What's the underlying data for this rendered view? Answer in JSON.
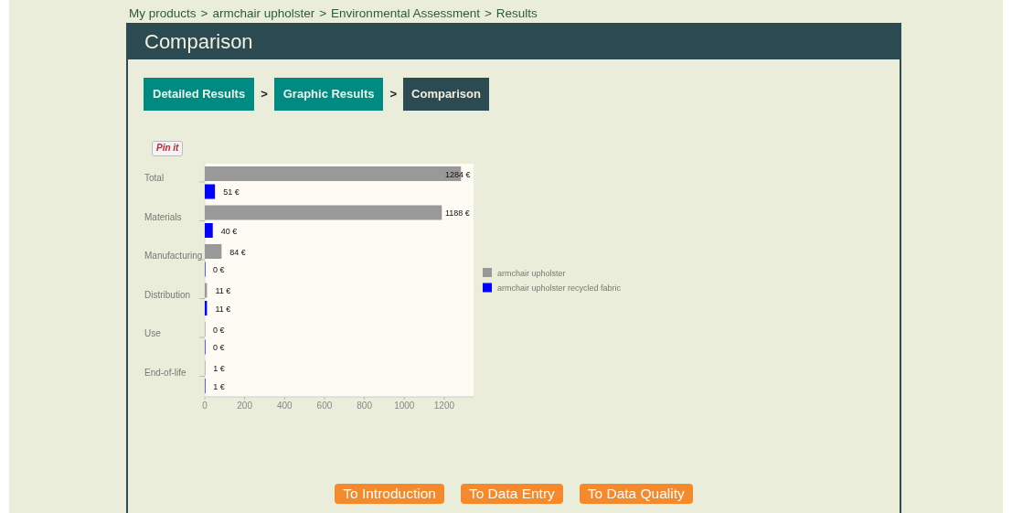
{
  "breadcrumb": [
    "My products",
    "armchair upholster",
    "Environmental Assessment",
    "Results"
  ],
  "breadcrumb_separator": ">",
  "page_title": "Comparison",
  "steps": [
    {
      "label": "Detailed Results",
      "selected": false
    },
    {
      "label": "Graphic Results",
      "selected": false
    },
    {
      "label": "Comparison",
      "selected": true
    }
  ],
  "step_separator": ">",
  "pin_button": "Pin it",
  "chart_data": {
    "type": "bar",
    "orientation": "horizontal",
    "categories": [
      "Total",
      "Materials",
      "Manufacturing",
      "Distribution",
      "Use",
      "End-of-life"
    ],
    "series": [
      {
        "name": "armchair upholster",
        "color": "#999999",
        "values": [
          1284,
          1188,
          84,
          11,
          0,
          1
        ],
        "value_labels": [
          "1284 €",
          "1188 €",
          "84 €",
          "11 €",
          "0 €",
          "1 €"
        ]
      },
      {
        "name": "armchair upholster recycled fabric",
        "color": "#0000ff",
        "values": [
          51,
          40,
          0,
          11,
          0,
          1
        ],
        "value_labels": [
          "51 €",
          "40 €",
          "0 €",
          "11 €",
          "0 €",
          "1 €"
        ]
      }
    ],
    "legend": true,
    "xlim": [
      0,
      1347
    ],
    "xticks": [
      0,
      200,
      400,
      600,
      800,
      1000,
      1200
    ]
  },
  "buttons": [
    "To Introduction",
    "To Data Entry",
    "To Data Quality"
  ]
}
